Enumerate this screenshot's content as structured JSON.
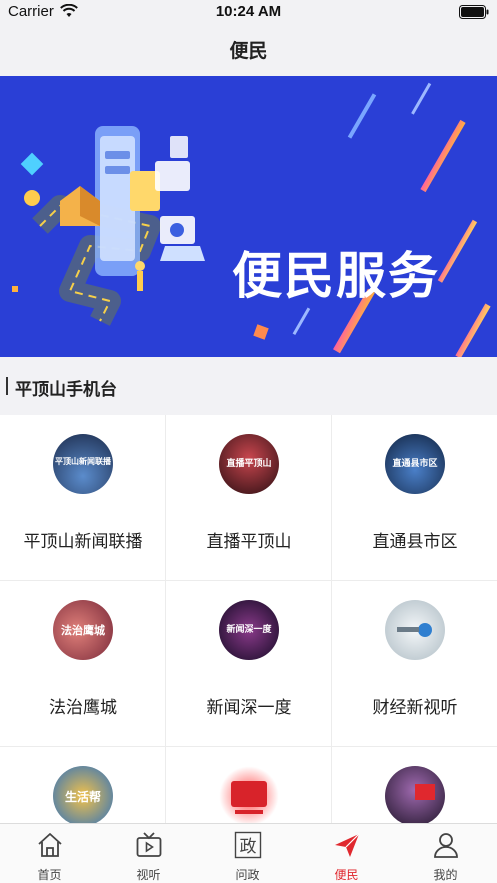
{
  "status_bar": {
    "carrier": "Carrier",
    "time": "10:24 AM"
  },
  "nav": {
    "title": "便民"
  },
  "banner": {
    "title": "便民服务",
    "page_count": 2,
    "active_page": 2
  },
  "section": {
    "title": "平顶山手机台"
  },
  "channels": [
    {
      "label": "平顶山新闻联播",
      "thumb_text": "平顶山新闻联播",
      "thumb_color": "#1b2a4a"
    },
    {
      "label": "直播平顶山",
      "thumb_text": "直播平顶山",
      "thumb_color": "#3a1418"
    },
    {
      "label": "直通县市区",
      "thumb_text": "直通县市区",
      "thumb_color": "#1e3a6a"
    },
    {
      "label": "法治鹰城",
      "thumb_text": "法治鹰城",
      "thumb_color": "#b83a3a"
    },
    {
      "label": "新闻深一度",
      "thumb_text": "新闻深一度",
      "thumb_color": "#2a1a40"
    },
    {
      "label": "财经新视听",
      "thumb_text": "",
      "thumb_color": "#cfd8dd"
    },
    {
      "label": "",
      "thumb_text": "生活帮",
      "thumb_color": "#2a6fc0"
    },
    {
      "label": "",
      "thumb_text": "",
      "thumb_color": "#d8232a"
    },
    {
      "label": "",
      "thumb_text": "",
      "thumb_color": "#3a2a40"
    }
  ],
  "tabs": [
    {
      "label": "首页",
      "icon": "home-icon",
      "active": false
    },
    {
      "label": "视听",
      "icon": "tv-icon",
      "active": false
    },
    {
      "label": "问政",
      "icon": "zheng-icon",
      "glyph": "政",
      "active": false
    },
    {
      "label": "便民",
      "icon": "paper-plane-icon",
      "active": true
    },
    {
      "label": "我的",
      "icon": "user-icon",
      "active": false
    }
  ],
  "colors": {
    "accent": "#e0282e",
    "banner_bg": "#2a3fd6",
    "section_bg": "#f2f2f5"
  }
}
